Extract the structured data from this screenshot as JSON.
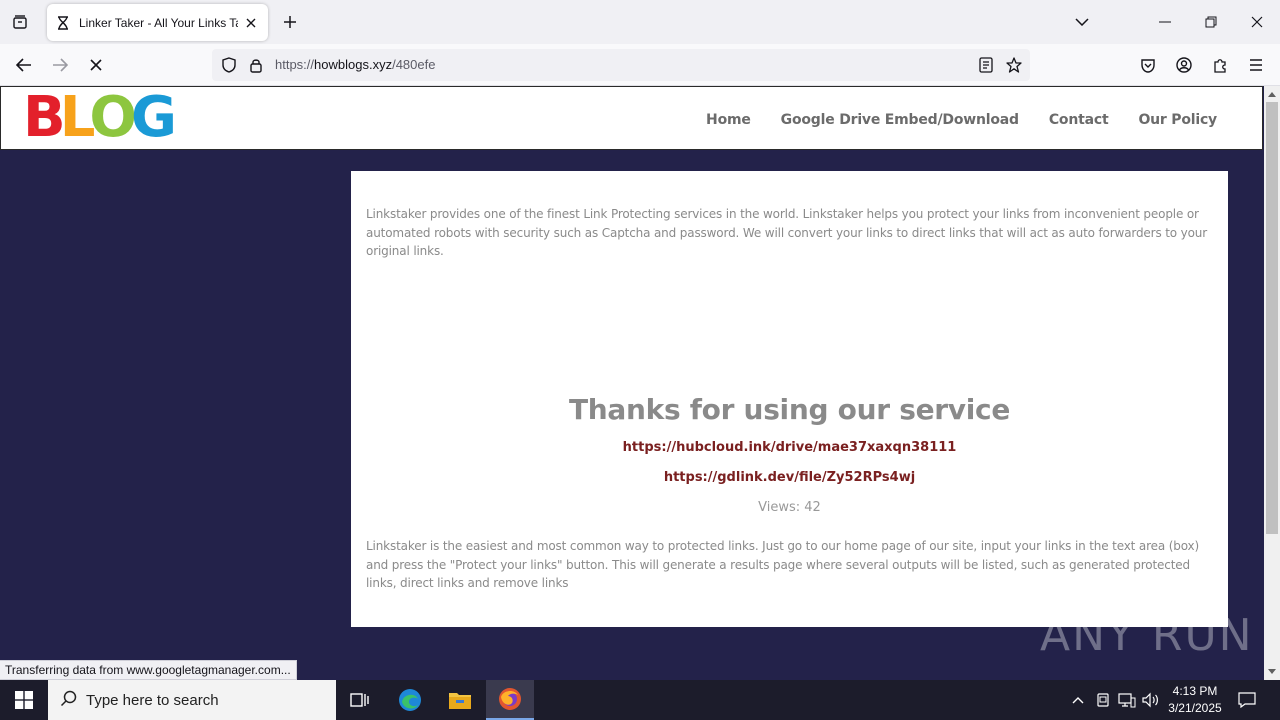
{
  "browser": {
    "tab_title": "Linker Taker - All Your Links Taken",
    "url_prefix": "https://",
    "url_host": "howblogs.xyz",
    "url_path": "/480efe"
  },
  "site": {
    "logo_letters": [
      {
        "ch": "B",
        "color": "#e3202b"
      },
      {
        "ch": "L",
        "color": "#f7a21b"
      },
      {
        "ch": "O",
        "color": "#8dc63f"
      },
      {
        "ch": "G",
        "color": "#1a9ad6"
      }
    ],
    "menu": [
      "Home",
      "Google Drive Embed/Download",
      "Contact",
      "Our Policy"
    ]
  },
  "content": {
    "intro": "Linkstaker provides one of the finest Link Protecting services in the world. Linkstaker helps you protect your links from inconvenient people or automated robots with security such as Captcha and password. We will convert your links to direct links that will act as auto forwarders to your original links.",
    "thanks": "Thanks for using our service",
    "link1": "https://hubcloud.ink/drive/mae37xaxqn38111",
    "link2": "https://gdlink.dev/file/Zy52RPs4wj",
    "views": "Views: 42",
    "outro": "Linkstaker is the easiest and most common way to protected links. Just go to our home page of our site, input your links in the text area (box) and press the \"Protect your links\" button. This will generate a results page where several outputs will be listed, such as generated protected links, direct links and remove links"
  },
  "status_bar": "Transferring data from www.googletagmanager.com...",
  "watermark": "ANY RUN",
  "taskbar": {
    "search_placeholder": "Type here to search",
    "time": "4:13 PM",
    "date": "3/21/2025"
  }
}
